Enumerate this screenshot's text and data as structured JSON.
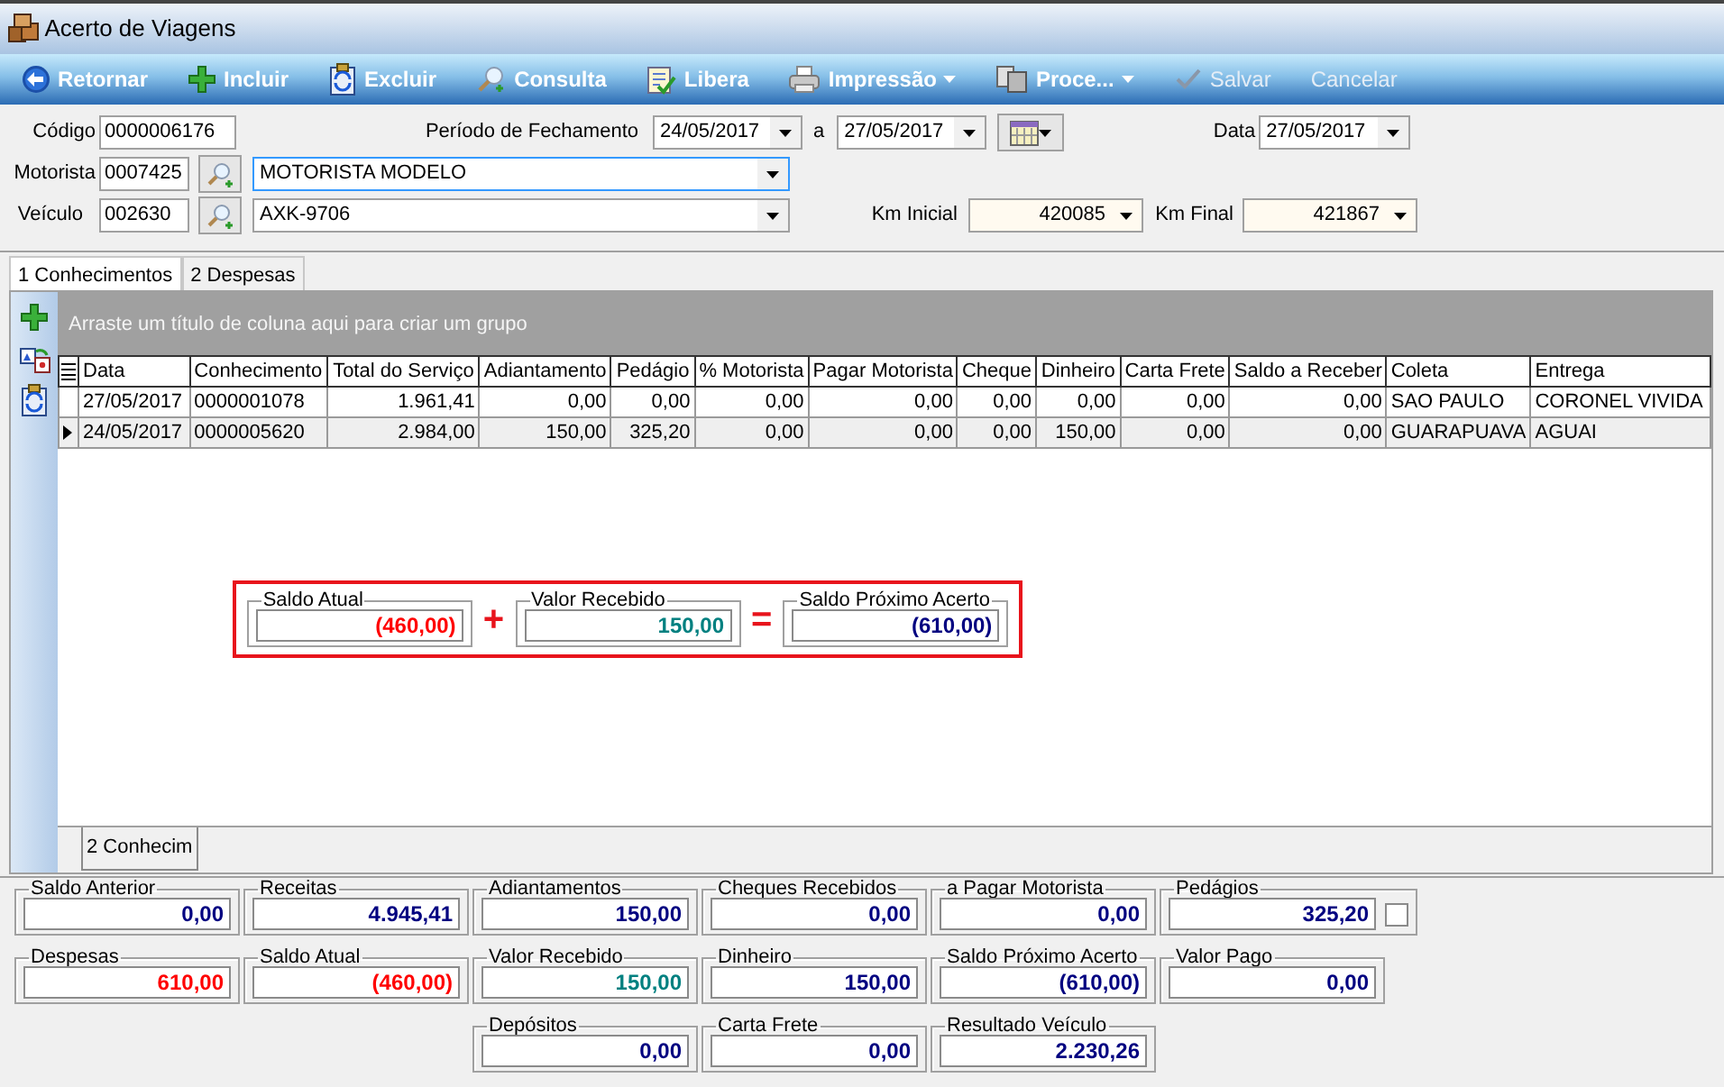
{
  "window": {
    "title": "Acerto de Viagens"
  },
  "toolbar": [
    {
      "label": "Retornar",
      "kind": "back",
      "disabled": false,
      "dropdown": false
    },
    {
      "label": "Incluir",
      "kind": "plus",
      "disabled": false,
      "dropdown": false
    },
    {
      "label": "Excluir",
      "kind": "clipboard",
      "disabled": false,
      "dropdown": false
    },
    {
      "label": "Consulta",
      "kind": "search",
      "disabled": false,
      "dropdown": false
    },
    {
      "label": "Libera",
      "kind": "notepad",
      "disabled": false,
      "dropdown": false
    },
    {
      "label": "Impressão",
      "kind": "printer",
      "disabled": false,
      "dropdown": true
    },
    {
      "label": "Proce...",
      "kind": "documents",
      "disabled": false,
      "dropdown": true
    },
    {
      "label": "Salvar",
      "kind": "check",
      "disabled": true,
      "dropdown": false
    },
    {
      "label": "Cancelar",
      "kind": "text",
      "disabled": true,
      "dropdown": false
    }
  ],
  "form": {
    "codigo": {
      "label": "Código",
      "value": "0000006176"
    },
    "periodo": {
      "label": "Período de Fechamento",
      "from": "24/05/2017",
      "separator": "a",
      "to": "27/05/2017"
    },
    "data": {
      "label": "Data",
      "value": "27/05/2017"
    },
    "motorista": {
      "label": "Motorista",
      "code": "0007425",
      "name": "MOTORISTA MODELO"
    },
    "veiculo": {
      "label": "Veículo",
      "code": "002630",
      "name": "AXK-9706"
    },
    "km_inicial": {
      "label": "Km Inicial",
      "value": "420085"
    },
    "km_final": {
      "label": "Km Final",
      "value": "421867"
    }
  },
  "tabs": [
    {
      "label": "1 Conhecimentos",
      "selected": true
    },
    {
      "label": "2 Despesas",
      "selected": false
    }
  ],
  "grid": {
    "group_hint": "Arraste um título de coluna aqui para criar um grupo",
    "columns": [
      {
        "label": "Data",
        "kind": "text"
      },
      {
        "label": "Conhecimento",
        "kind": "text"
      },
      {
        "label": "Total do Serviço",
        "kind": "number"
      },
      {
        "label": "Adiantamento",
        "kind": "number"
      },
      {
        "label": "Pedágio",
        "kind": "number"
      },
      {
        "label": "% Motorista",
        "kind": "number"
      },
      {
        "label": "Pagar Motorista",
        "kind": "number"
      },
      {
        "label": "Cheque",
        "kind": "number"
      },
      {
        "label": "Dinheiro",
        "kind": "number"
      },
      {
        "label": "Carta Frete",
        "kind": "number"
      },
      {
        "label": "Saldo a Receber",
        "kind": "number"
      },
      {
        "label": "Coleta",
        "kind": "text"
      },
      {
        "label": "Entrega",
        "kind": "text"
      }
    ],
    "rows": [
      {
        "selected": false,
        "cells": [
          "27/05/2017",
          "0000001078",
          "1.961,41",
          "0,00",
          "0,00",
          "0,00",
          "0,00",
          "0,00",
          "0,00",
          "0,00",
          "0,00",
          "SAO PAULO",
          "CORONEL VIVIDA"
        ]
      },
      {
        "selected": true,
        "cells": [
          "24/05/2017",
          "0000005620",
          "2.984,00",
          "150,00",
          "325,20",
          "0,00",
          "0,00",
          "0,00",
          "150,00",
          "0,00",
          "0,00",
          "GUARAPUAVA",
          "AGUAI"
        ]
      }
    ]
  },
  "balance": {
    "saldo_atual": {
      "label": "Saldo Atual",
      "value": "(460,00)",
      "color": "#ff0000"
    },
    "plus": "+",
    "valor_recebido": {
      "label": "Valor Recebido",
      "value": "150,00",
      "color": "#008080"
    },
    "equals": "=",
    "saldo_proximo": {
      "label": "Saldo Próximo Acerto",
      "value": "(610,00)",
      "color": "#000080"
    }
  },
  "bottom_tab": "2 Conhecim",
  "summary": {
    "left": [
      [
        {
          "label": "Saldo Anterior",
          "value": "0,00",
          "color": "#000080"
        },
        {
          "label": "Receitas",
          "value": "4.945,41",
          "color": "#000080"
        }
      ],
      [
        {
          "label": "Despesas",
          "value": "610,00",
          "color": "#ff0000"
        },
        {
          "label": "Saldo Atual",
          "value": "(460,00)",
          "color": "#ff0000"
        }
      ]
    ],
    "right": [
      [
        {
          "label": "Adiantamentos",
          "value": "150,00",
          "color": "#000080"
        },
        {
          "label": "Cheques Recebidos",
          "value": "0,00",
          "color": "#000080"
        },
        {
          "label": "a Pagar Motorista",
          "value": "0,00",
          "color": "#000080"
        },
        {
          "label": "Pedágios",
          "value": "325,20",
          "color": "#000080",
          "checked": false
        }
      ],
      [
        {
          "label": "Valor Recebido",
          "value": "150,00",
          "color": "#008080"
        },
        {
          "label": "Dinheiro",
          "value": "150,00",
          "color": "#000080"
        },
        {
          "label": "Saldo Próximo Acerto",
          "value": "(610,00)",
          "color": "#000080"
        },
        {
          "label": "Valor Pago",
          "value": "0,00",
          "color": "#000080"
        }
      ],
      [
        {
          "label": "Depósitos",
          "value": "0,00",
          "color": "#000080"
        },
        {
          "label": "Carta Frete",
          "value": "0,00",
          "color": "#000080"
        },
        {
          "label": "Resultado Veículo",
          "value": "2.230,26",
          "color": "#000080"
        }
      ]
    ]
  }
}
